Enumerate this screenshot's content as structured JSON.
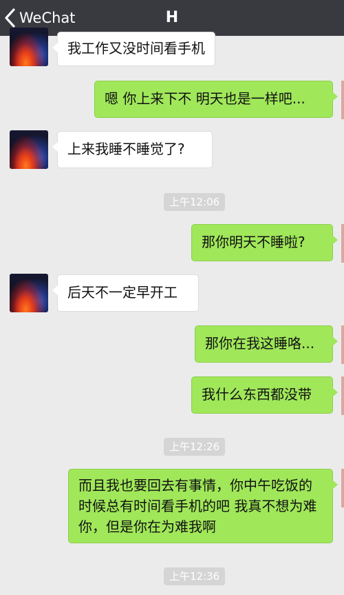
{
  "navbar": {
    "back_label": "WeChat",
    "title": "H"
  },
  "messages": {
    "m1": "我工作又没时间看手机",
    "m2": "嗯 你上来下不 明天也是一样吧...",
    "m3": "上来我睡不睡觉了?",
    "ts1": "上午12:06",
    "m4": "那你明天不睡啦?",
    "m5": "后天不一定早开工",
    "m6": "那你在我这睡咯...",
    "m7": "我什么东西都没带",
    "ts2": "上午12:26",
    "m8": "而且我也要回去有事情，你中午吃饭的时候总有时间看手机的吧 我真不想为难你，但是你在为难我啊",
    "ts3": "上午12:36"
  },
  "colors": {
    "navbar_bg": "#393a3f",
    "chat_bg": "#ebebeb",
    "sent_bubble": "#a0e75a",
    "received_bubble": "#ffffff",
    "timestamp_bg": "#d5d5d5"
  }
}
